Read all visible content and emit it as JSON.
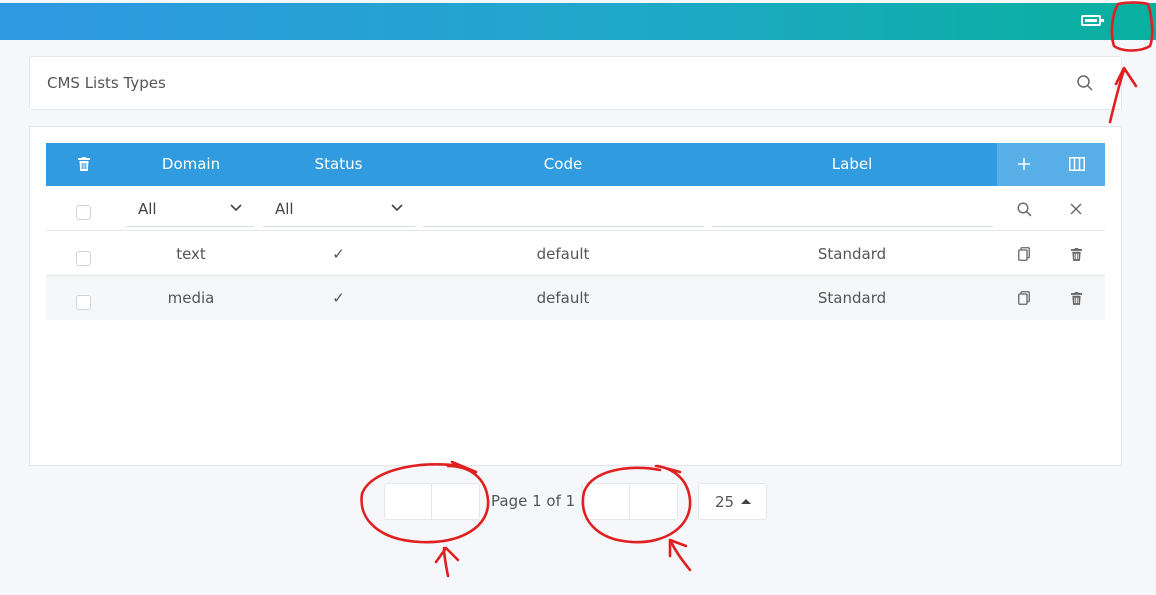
{
  "search": {
    "title": "CMS Lists Types"
  },
  "table": {
    "headers": {
      "domain": "Domain",
      "status": "Status",
      "code": "Code",
      "label": "Label"
    },
    "filters": {
      "domain": "All",
      "status": "All"
    },
    "rows": [
      {
        "domain": "text",
        "status": "✓",
        "code": "default",
        "label": "Standard"
      },
      {
        "domain": "media",
        "status": "✓",
        "code": "default",
        "label": "Standard"
      }
    ]
  },
  "pagination": {
    "text": "Page 1 of 1",
    "page_size": "25"
  },
  "colors": {
    "header": "#319be0",
    "header_actions": "#58aee6",
    "topbar_start": "#2f98e3",
    "topbar_end": "#08b09e",
    "annotation": "#e02020"
  },
  "icons": [
    "battery-icon",
    "search-icon",
    "trash-icon",
    "plus-icon",
    "columns-icon",
    "chevron-down-icon",
    "close-icon",
    "copy-icon",
    "check-icon",
    "caret-up-icon"
  ]
}
